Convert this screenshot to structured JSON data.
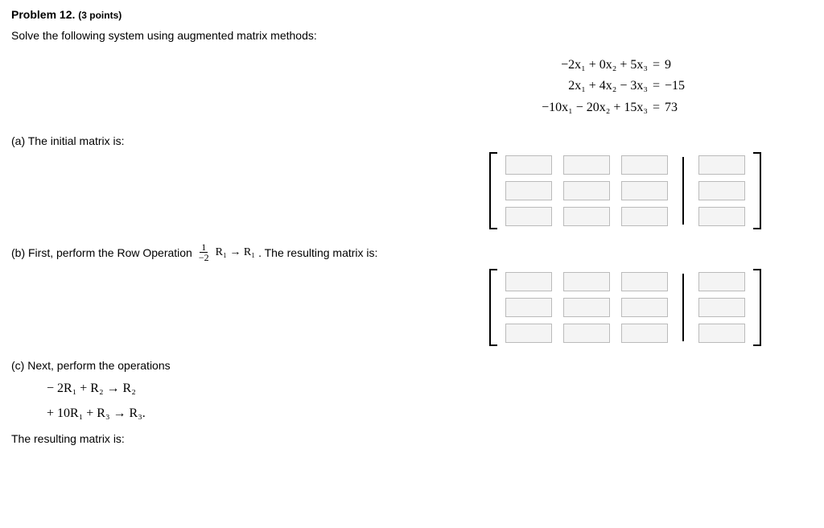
{
  "problem": {
    "number_label": "Problem 12.",
    "points_label": "(3 points)",
    "instruction": "Solve the following system using augmented matrix methods:"
  },
  "equations": [
    {
      "lhs": "−2x₁ + 0x₂ + 5x₃",
      "rhs": "9"
    },
    {
      "lhs": "2x₁ + 4x₂ − 3x₃",
      "rhs": "−15"
    },
    {
      "lhs": "−10x₁ − 20x₂ + 15x₃",
      "rhs": "73"
    }
  ],
  "parts": {
    "a_label": "(a) The initial matrix is:",
    "b_prefix": "(b) First, perform the Row Operation ",
    "b_frac_num": "1",
    "b_frac_den": "−2",
    "b_op": "R₁ → R₁",
    "b_suffix": ". The resulting matrix is:",
    "c_label": "(c) Next, perform the operations",
    "c_op1": "− 2R₁ + R₂ → R₂",
    "c_op2": "+ 10R₁ + R₃ → R₃.",
    "c_result": "The resulting matrix is:"
  },
  "eq_sign": "="
}
